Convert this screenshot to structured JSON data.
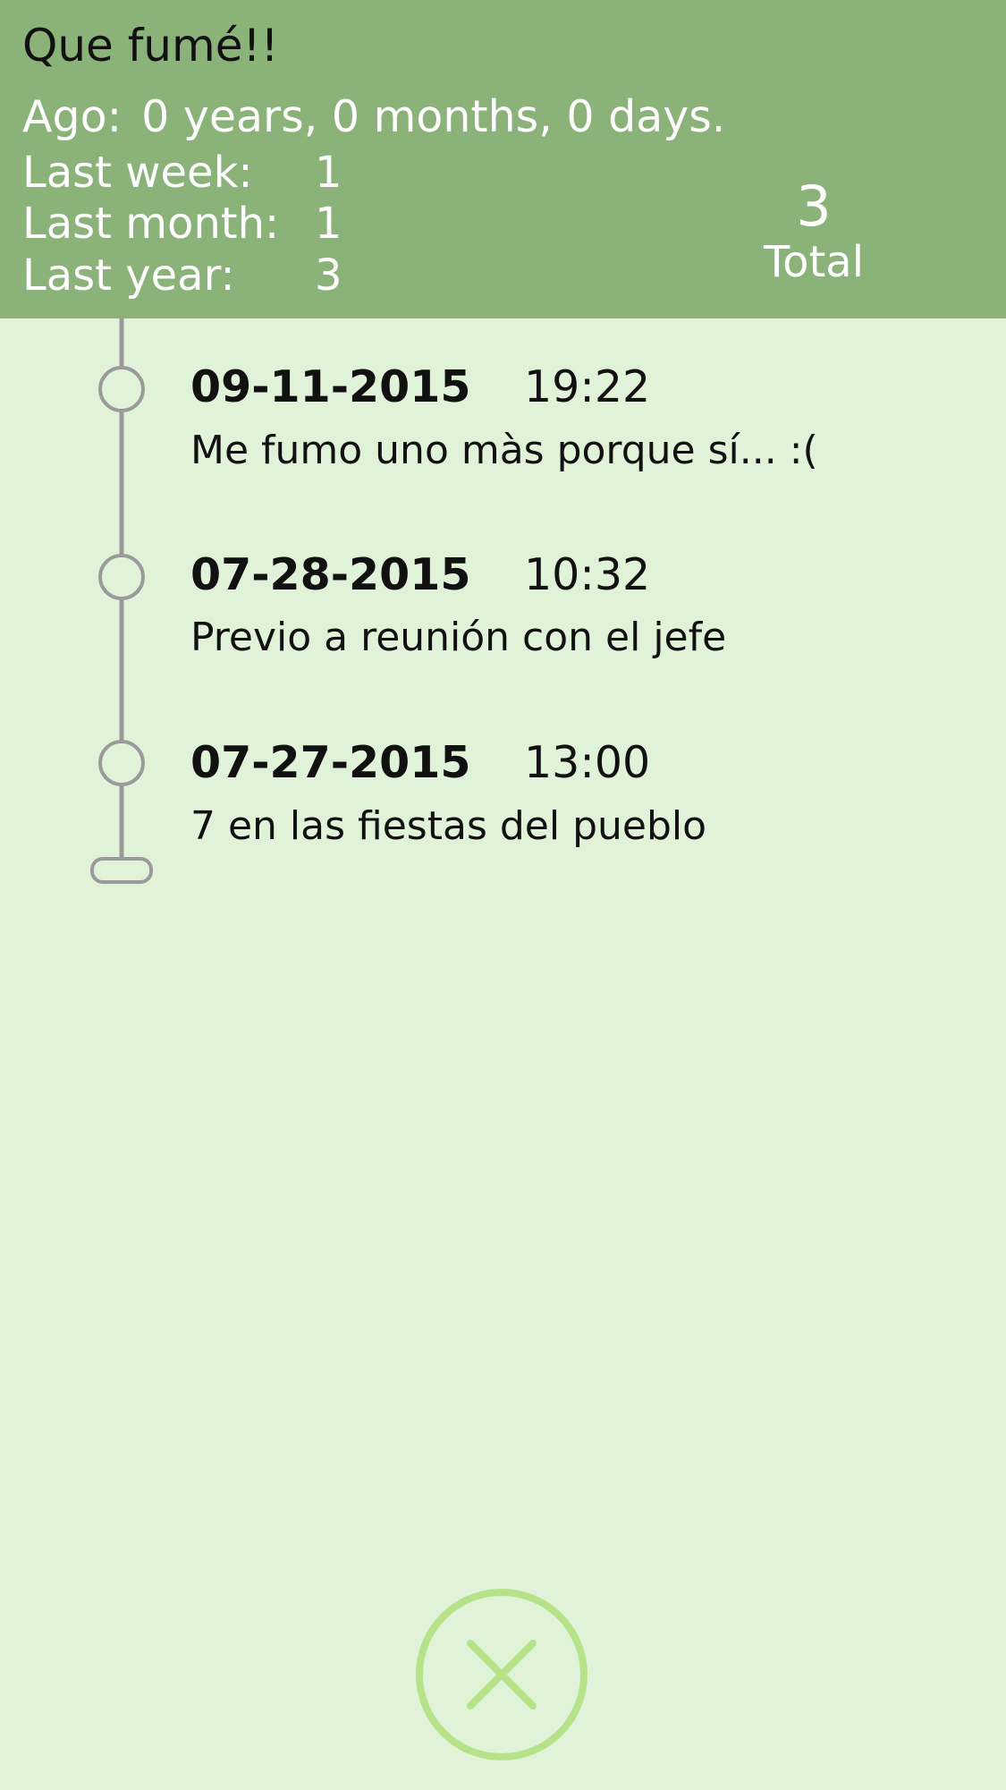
{
  "header": {
    "title": "Que fumé!!",
    "ago_label": "Ago:",
    "ago_value": "0 years, 0 months, 0 days.",
    "stats": [
      {
        "label": "Last week:",
        "value": "1"
      },
      {
        "label": "Last month:",
        "value": "1"
      },
      {
        "label": "Last year:",
        "value": "3"
      }
    ],
    "total_value": "3",
    "total_label": "Total"
  },
  "entries": [
    {
      "date": "09-11-2015",
      "time": "19:22",
      "note": "Me fumo uno màs porque sí... :("
    },
    {
      "date": "07-28-2015",
      "time": "10:32",
      "note": "Previo a reunión con el jefe"
    },
    {
      "date": "07-27-2015",
      "time": "13:00",
      "note": "7 en las fiestas del pueblo"
    }
  ],
  "icons": {
    "close": "close-x-icon",
    "timeline_node": "timeline-node-icon"
  },
  "colors": {
    "header_bg": "#8ab279",
    "page_bg": "#e0f2d7",
    "close_accent": "#b6e38a",
    "timeline": "#9a9a9a"
  }
}
